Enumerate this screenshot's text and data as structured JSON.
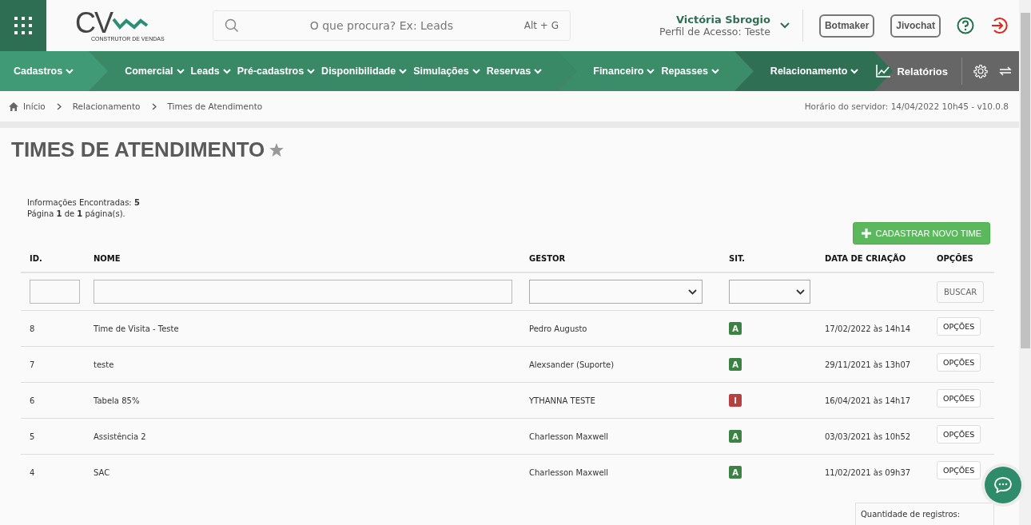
{
  "header": {
    "logo": {
      "mark": "CV",
      "tagline": "CONSTRUTOR DE VENDAS"
    },
    "search": {
      "placeholder": "O que procura? Ex: Leads",
      "shortcut": "Alt + G"
    },
    "user": {
      "name": "Victória Sbrogio",
      "profile": "Perfil de Acesso: Teste"
    },
    "buttons": [
      "Botmaker",
      "Jivochat"
    ]
  },
  "nav": {
    "groups": [
      {
        "color": "#3f9a75",
        "items": [
          "Cadastros"
        ]
      },
      {
        "color": "#398866",
        "items": [
          "Comercial",
          "Leads",
          "Pré-cadastros",
          "Disponibilidade",
          "Simulações",
          "Reservas"
        ]
      },
      {
        "color": "#3b8c69",
        "items": [
          "Financeiro",
          "Repasses"
        ]
      },
      {
        "color": "#2f7055",
        "items": [
          "Relacionamento"
        ]
      }
    ],
    "reports": "Relatórios"
  },
  "breadcrumb": [
    "Início",
    "Relacionamento",
    "Times de Atendimento"
  ],
  "server_time": "Horário do servidor: 14/04/2022 10h45 - v10.0.8",
  "title": "TIMES DE ATENDIMENTO",
  "info": [
    "Informações Encontradas: **5**",
    "Página **1** de **1** página(s)."
  ],
  "new_button": "CADASTRAR NOVO TIME",
  "table": {
    "columns": [
      "ID.",
      "NOME",
      "GESTOR",
      "SIT.",
      "DATA DE CRIAÇÃO",
      "OPÇÕES"
    ],
    "search_button": "BUSCAR",
    "rows": [
      {
        "id": "8",
        "name": "Time de Visita - Teste",
        "manager": "Pedro Augusto",
        "status": {
          "label": "A",
          "color": "#3b8343"
        },
        "created": "17/02/2022 às 14h14",
        "action": "OPÇÕES"
      },
      {
        "id": "7",
        "name": "teste",
        "manager": "Alexsander (Suporte)",
        "status": {
          "label": "A",
          "color": "#3b8343"
        },
        "created": "29/11/2021 às 13h07",
        "action": "OPÇÕES"
      },
      {
        "id": "6",
        "name": "Tabela 85%",
        "manager": "YTHANNA TESTE",
        "status": {
          "label": "I",
          "color": "#b6413e"
        },
        "created": "16/04/2021 às 14h17",
        "action": "OPÇÕES"
      },
      {
        "id": "5",
        "name": "Assistência 2",
        "manager": "Charlesson Maxwell",
        "status": {
          "label": "A",
          "color": "#3b8343"
        },
        "created": "03/03/2021 às 10h52",
        "action": "OPÇÕES"
      },
      {
        "id": "4",
        "name": "SAC",
        "manager": "Charlesson Maxwell",
        "status": {
          "label": "A",
          "color": "#3b8343"
        },
        "created": "11/02/2021 às 09h37",
        "action": "OPÇÕES"
      }
    ]
  },
  "records_label": "Quantidade de registros:"
}
